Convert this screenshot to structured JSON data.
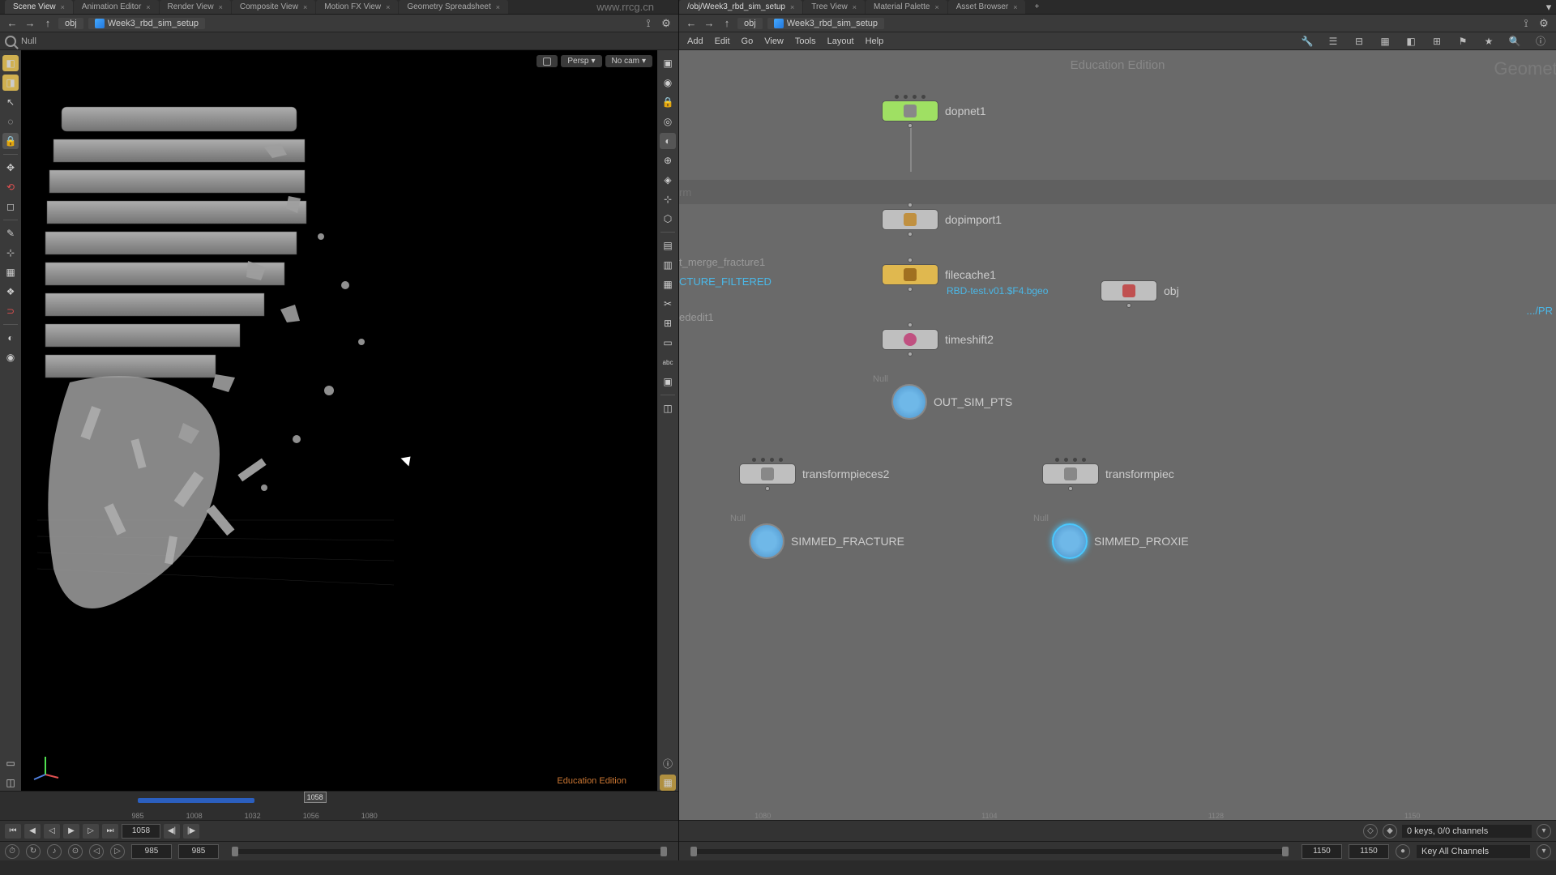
{
  "left_tabs": [
    "Scene View",
    "Animation Editor",
    "Render View",
    "Composite View",
    "Motion FX View",
    "Geometry Spreadsheet"
  ],
  "right_tabs": [
    "/obj/Week3_rbd_sim_setup",
    "Tree View",
    "Material Palette",
    "Asset Browser"
  ],
  "watermark_url": "www.rrcg.cn",
  "nav_left": {
    "obj": "obj",
    "file": "Week3_rbd_sim_setup"
  },
  "nav_right": {
    "obj": "obj",
    "file": "Week3_rbd_sim_setup"
  },
  "search": "Null",
  "vp": {
    "camera": "Persp",
    "cam_lock": "No cam",
    "edu": "Education Edition"
  },
  "timeline": {
    "ticks": [
      985,
      1008,
      1032,
      1056,
      1080,
      1104,
      1128,
      1150
    ],
    "current": 1058,
    "range_end": 1058,
    "frame": 1058,
    "start": 985
  },
  "bottom": {
    "a": "985",
    "b": "985",
    "right_a": "1150",
    "right_b": "1150"
  },
  "menu": [
    "Add",
    "Edit",
    "Go",
    "View",
    "Tools",
    "Layout",
    "Help"
  ],
  "net": {
    "edu": "Education Edition",
    "geo": "Geometry",
    "side_merge": "t_merge_fracture1",
    "side_filtered": "CTURE_FILTERED",
    "side_edit": "ededit1",
    "side_rm": "rm",
    "side_obj": "obj",
    "side_pr": ".../PR"
  },
  "nodes": {
    "dopnet1": "dopnet1",
    "dopimport1": "dopimport1",
    "filecache1": "filecache1",
    "filecache_sub": "RBD-test.v01.$F4.bgeo",
    "timeshift2": "timeshift2",
    "out_sim": "OUT_SIM_PTS",
    "null_pre": "Null",
    "transformpieces2": "transformpieces2",
    "transformpiecesR": "transformpiec",
    "simmed_fracture": "SIMMED_FRACTURE",
    "simmed_proxie": "SIMMED_PROXIE"
  },
  "keys": {
    "status": "0 keys, 0/0 channels",
    "mode": "Key All Channels"
  }
}
